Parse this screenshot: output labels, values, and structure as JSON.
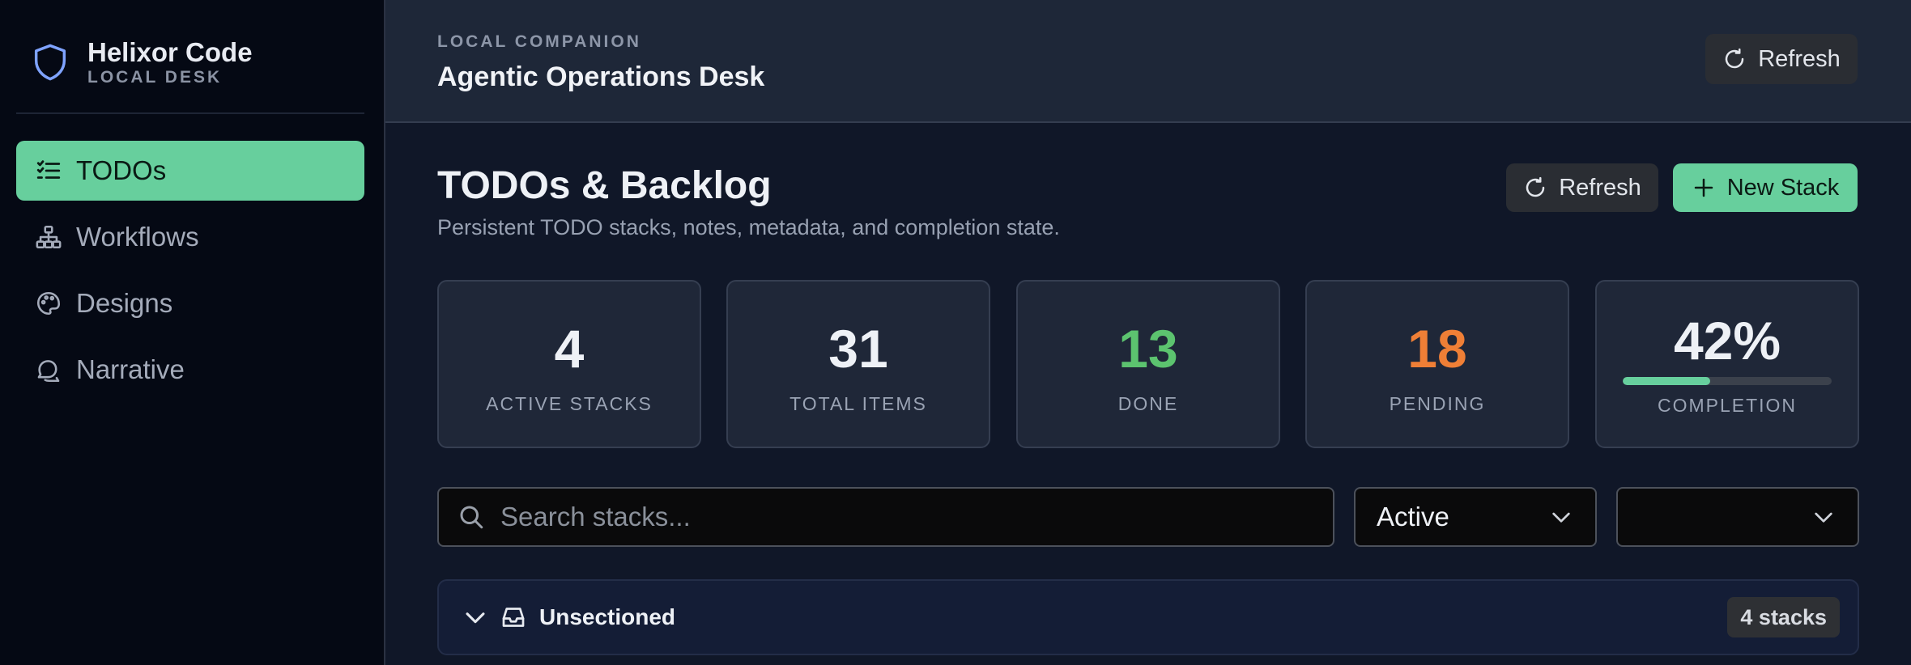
{
  "sidebar": {
    "brand_name": "Helixor Code",
    "brand_sub": "LOCAL DESK",
    "items": [
      {
        "label": "TODOs",
        "icon": "list-check-icon",
        "active": true
      },
      {
        "label": "Workflows",
        "icon": "sitemap-icon",
        "active": false
      },
      {
        "label": "Designs",
        "icon": "palette-icon",
        "active": false
      },
      {
        "label": "Narrative",
        "icon": "chat-bubbles-icon",
        "active": false
      }
    ]
  },
  "topbar": {
    "eyebrow": "LOCAL COMPANION",
    "title": "Agentic Operations Desk",
    "refresh_label": "Refresh"
  },
  "page": {
    "title": "TODOs & Backlog",
    "description": "Persistent TODO stacks, notes, metadata, and completion state.",
    "refresh_label": "Refresh",
    "new_stack_label": "New Stack"
  },
  "stats": [
    {
      "value": "4",
      "label": "ACTIVE STACKS",
      "color": "#eef1f6"
    },
    {
      "value": "31",
      "label": "TOTAL ITEMS",
      "color": "#eef1f6"
    },
    {
      "value": "13",
      "label": "DONE",
      "color": "#5cc36f"
    },
    {
      "value": "18",
      "label": "PENDING",
      "color": "#ef7f36"
    },
    {
      "value": "42%",
      "label": "COMPLETION",
      "color": "#eef1f6",
      "progress": 0.42
    }
  ],
  "filters": {
    "search_placeholder": "Search stacks...",
    "status_value": "Active",
    "second_value": ""
  },
  "section": {
    "label": "Unsectioned",
    "count": "4 stacks"
  },
  "colors": {
    "accent": "#67cf9d",
    "done": "#5cc36f",
    "pending": "#ef7f36"
  }
}
